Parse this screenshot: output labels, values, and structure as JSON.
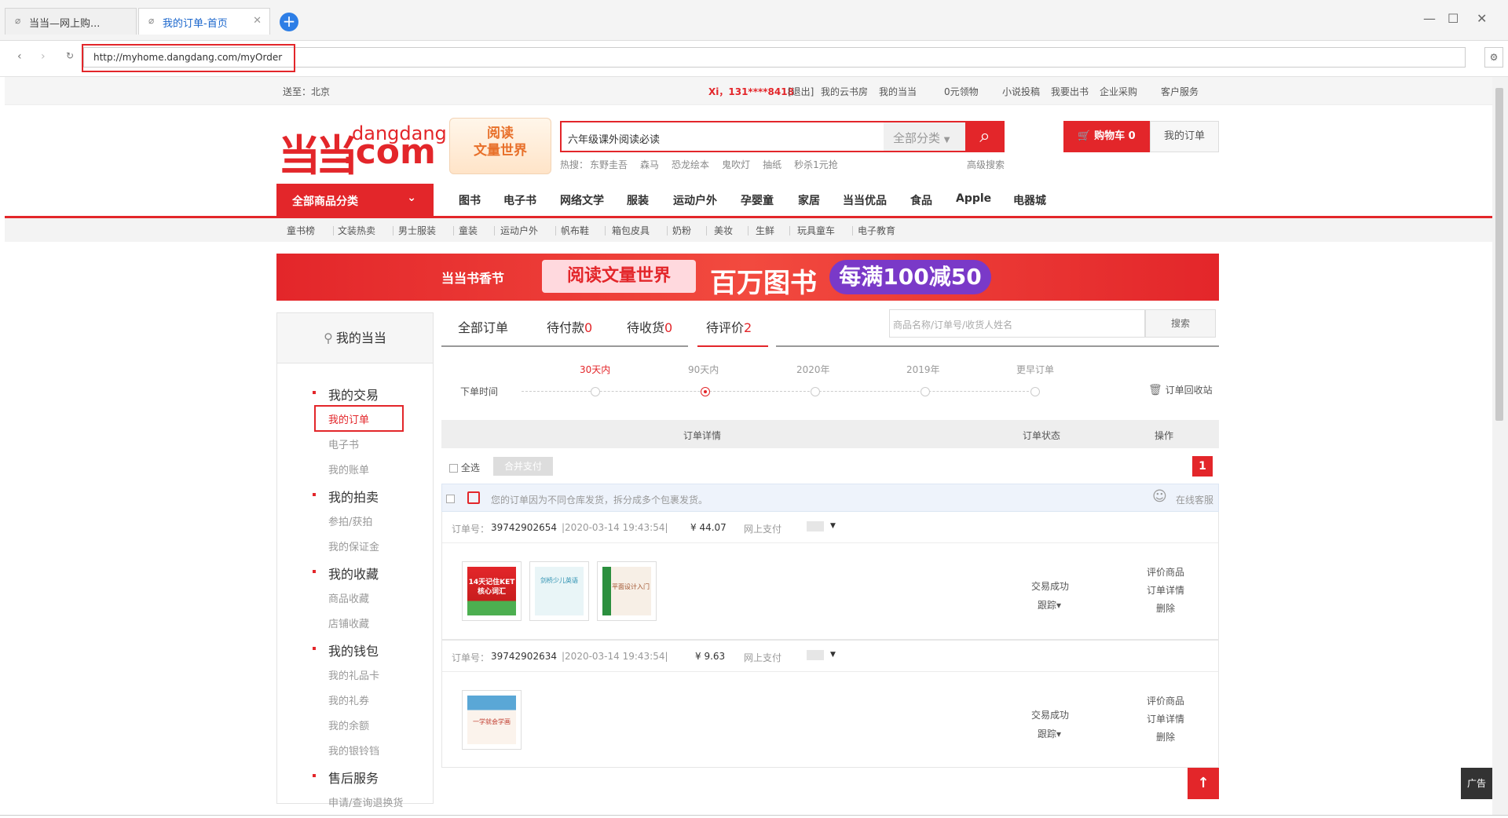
{
  "browser": {
    "tabs": [
      {
        "label": "当当—网上购..."
      },
      {
        "label": "我的订单-首页"
      }
    ],
    "new_tab": "+",
    "url": "http://myhome.dangdang.com/myOrder"
  },
  "topbar": {
    "deliver": "送至：北京",
    "user": "Xi，131****8418",
    "logout": "[退出]",
    "links": [
      "我的云书房",
      "我的当当",
      "0元领物",
      "小说投稿",
      "我要出书",
      "企业采购",
      "客户服务"
    ]
  },
  "logo": {
    "mark": "当当",
    "dd": "dangdang",
    "com": ".com"
  },
  "promo": {
    "line1": "阅读",
    "line2": "文量世界"
  },
  "search": {
    "query": "六年级课外阅读必读",
    "category": "全部分类",
    "hot_label": "热搜：",
    "hot": [
      "东野圭吾",
      "森马",
      "恐龙绘本",
      "鬼吹灯",
      "抽纸",
      "秒杀1元抢"
    ],
    "advanced": "高级搜索"
  },
  "cart": {
    "label": "购物车 0",
    "orders": "我的订单"
  },
  "nav": {
    "all": "全部商品分类",
    "items": [
      "图书",
      "电子书",
      "网络文学",
      "服装",
      "运动户外",
      "孕婴童",
      "家居",
      "当当优品",
      "食品",
      "Apple",
      "电器城"
    ],
    "sub": [
      "童书榜",
      "文装热卖",
      "男士服装",
      "童装",
      "运动户外",
      "帆布鞋",
      "箱包皮具",
      "奶粉",
      "美妆",
      "生鲜",
      "玩具童车",
      "电子教育"
    ]
  },
  "banner": {
    "festival": "当当书香节",
    "slogan": "阅读文量世界",
    "million": "百万图书",
    "deal": "每满100减50"
  },
  "sidebar": {
    "title": "我的当当",
    "sections": [
      {
        "title": "我的交易",
        "items": [
          "我的订单",
          "电子书",
          "我的账单"
        ]
      },
      {
        "title": "我的拍卖",
        "items": [
          "参拍/获拍",
          "我的保证金"
        ]
      },
      {
        "title": "我的收藏",
        "items": [
          "商品收藏",
          "店铺收藏"
        ]
      },
      {
        "title": "我的钱包",
        "items": [
          "我的礼品卡",
          "我的礼券",
          "我的余额",
          "我的银铃铛"
        ]
      },
      {
        "title": "售后服务",
        "items": [
          "申请/查询退换货"
        ]
      }
    ]
  },
  "order_tabs": [
    {
      "label": "全部订单",
      "count": ""
    },
    {
      "label": "待付款",
      "count": "0"
    },
    {
      "label": "待收货",
      "count": "0"
    },
    {
      "label": "待评价",
      "count": "2"
    }
  ],
  "order_search": {
    "placeholder": "商品名称/订单号/收货人姓名",
    "button": "搜索"
  },
  "timeline": {
    "label": "下单时间",
    "options": [
      "30天内",
      "90天内",
      "2020年",
      "2019年",
      "更早订单"
    ],
    "recycle": "订单回收站"
  },
  "table": {
    "cols": [
      "订单详情",
      "订单状态",
      "操作"
    ]
  },
  "batch": {
    "select_all": "全选",
    "pay": "合并支付",
    "page": "1"
  },
  "notice": {
    "text": "您的订单因为不同仓库发货，拆分成多个包裹发货。",
    "service": "在线客服"
  },
  "orders": [
    {
      "label": "订单号：",
      "id": "39742902654",
      "time": "|2020-03-14 19:43:54|",
      "price": "¥ 44.07",
      "pay": "网上支付",
      "status": "交易成功",
      "track": "跟踪▾",
      "actions": [
        "评价商品",
        "订单详情",
        "删除"
      ]
    },
    {
      "label": "订单号：",
      "id": "39742902634",
      "time": "|2020-03-14 19:43:54|",
      "price": "¥ 9.63",
      "pay": "网上支付",
      "status": "交易成功",
      "track": "跟踪▾",
      "actions": [
        "评价商品",
        "订单详情",
        "删除"
      ]
    }
  ],
  "thumbs": {
    "a": "14天记住KET核心词汇",
    "b": "剑桥少儿英语",
    "c": "平面设计入门",
    "d": "一学就会学画"
  },
  "ad": "广告",
  "colors": {
    "brand_red": "#e3262a",
    "link_blue": "#1a66cc"
  }
}
